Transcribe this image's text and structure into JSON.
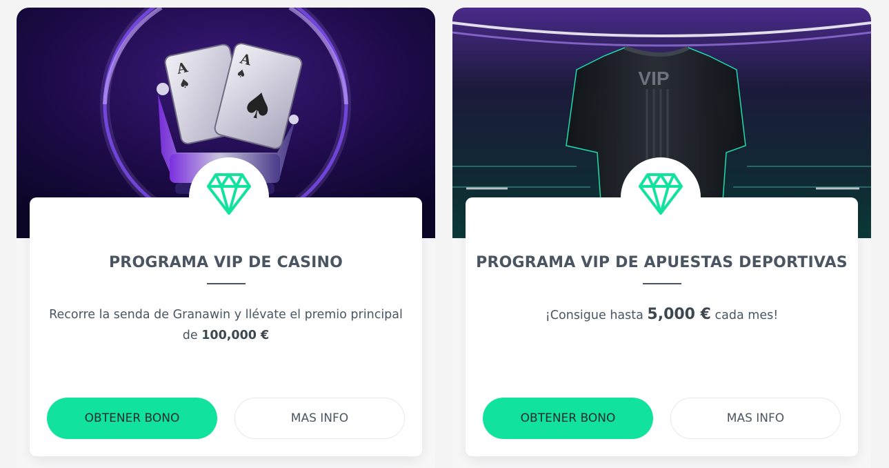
{
  "cards": [
    {
      "title": "PROGRAMA VIP DE CASINO",
      "desc_text": "Recorre la senda de Granawin y llévate el premio principal de ",
      "desc_highlight": "100,000 €",
      "desc_suffix": "",
      "primary_button": "OBTENER BONO",
      "secondary_button": "MAS INFO",
      "badge_icon": "diamond-icon",
      "hero_image": "playing-cards-crown"
    },
    {
      "title": "PROGRAMA VIP DE APUESTAS DEPORTIVAS",
      "desc_text": "¡Consigue hasta ",
      "desc_highlight": "5,000 €",
      "desc_suffix": " cada mes!",
      "primary_button": "OBTENER BONO",
      "secondary_button": "MAS INFO",
      "badge_icon": "diamond-icon",
      "hero_image": "vip-jersey",
      "jersey_text": "VIP"
    }
  ],
  "colors": {
    "accent": "#11e39e",
    "text": "#4a5561",
    "hero1_bg": "#2a0f5e",
    "hero2_bg": "#151a2e"
  }
}
